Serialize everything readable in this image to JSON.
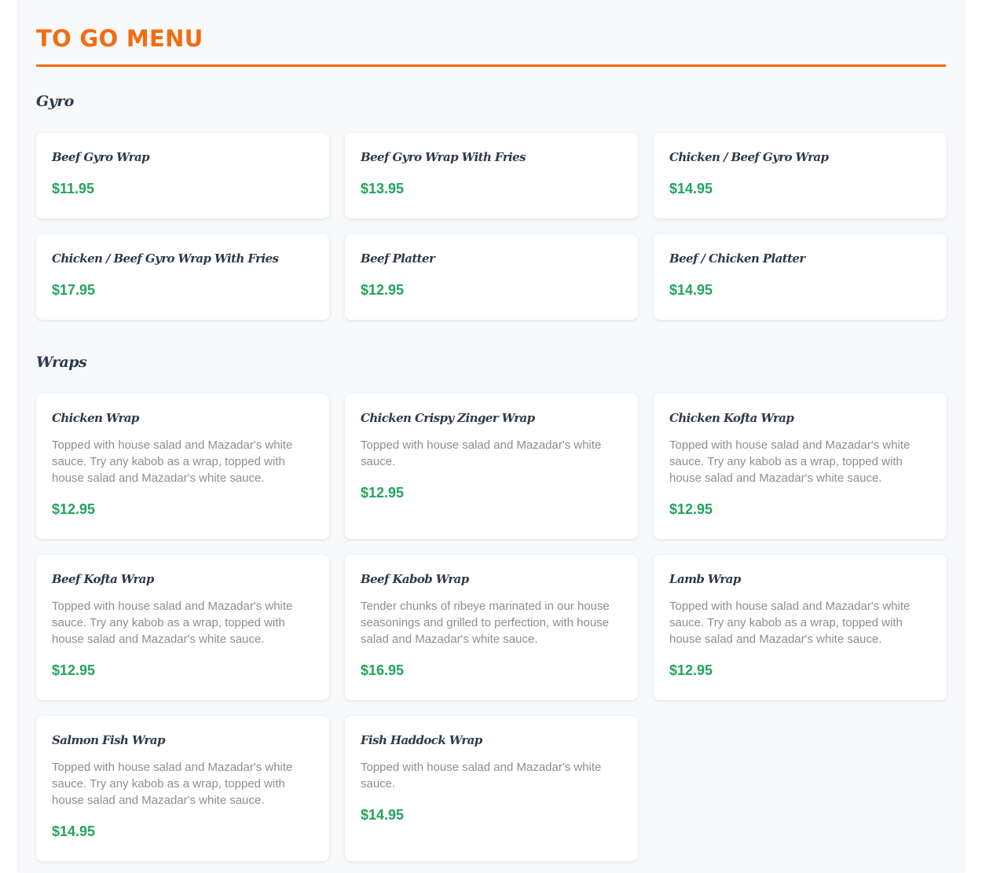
{
  "menu": {
    "title": "TO GO MENU"
  },
  "sections": {
    "gyro": {
      "title": "Gyro",
      "items": [
        {
          "name": "Beef Gyro Wrap",
          "price": "$11.95"
        },
        {
          "name": "Beef Gyro Wrap With Fries",
          "price": "$13.95"
        },
        {
          "name": "Chicken / Beef Gyro Wrap",
          "price": "$14.95"
        },
        {
          "name": "Chicken / Beef Gyro Wrap With Fries",
          "price": "$17.95"
        },
        {
          "name": "Beef Platter",
          "price": "$12.95"
        },
        {
          "name": "Beef / Chicken Platter",
          "price": "$14.95"
        }
      ]
    },
    "wraps": {
      "title": "Wraps",
      "items": [
        {
          "name": "Chicken Wrap",
          "description": "Topped with house salad and Mazadar's white sauce. Try any kabob as a wrap, topped with house salad and Mazadar's white sauce.",
          "price": "$12.95"
        },
        {
          "name": "Chicken Crispy Zinger Wrap",
          "description": "Topped with house salad and Mazadar's white sauce.",
          "price": "$12.95"
        },
        {
          "name": "Chicken Kofta Wrap",
          "description": "Topped with house salad and Mazadar's white sauce. Try any kabob as a wrap, topped with house salad and Mazadar's white sauce.",
          "price": "$12.95"
        },
        {
          "name": "Beef Kofta Wrap",
          "description": "Topped with house salad and Mazadar's white sauce. Try any kabob as a wrap, topped with house salad and Mazadar's white sauce.",
          "price": "$12.95"
        },
        {
          "name": "Beef Kabob Wrap",
          "description": "Tender chunks of ribeye marinated in our house seasonings and grilled to perfection, with house salad and Mazadar's white sauce.",
          "price": "$16.95"
        },
        {
          "name": "Lamb Wrap",
          "description": "Topped with house salad and Mazadar's white sauce. Try any kabob as a wrap, topped with house salad and Mazadar's white sauce.",
          "price": "$12.95"
        },
        {
          "name": "Salmon Fish Wrap",
          "description": "Topped with house salad and Mazadar's white sauce. Try any kabob as a wrap, topped with house salad and Mazadar's white sauce.",
          "price": "$14.95"
        },
        {
          "name": "Fish Haddock Wrap",
          "description": "Topped with house salad and Mazadar's white sauce.",
          "price": "$14.95"
        }
      ]
    }
  },
  "colors": {
    "accent": "#f36c10",
    "price": "#22a45d",
    "heading": "#2d3a4b",
    "description": "#8a8f95"
  }
}
